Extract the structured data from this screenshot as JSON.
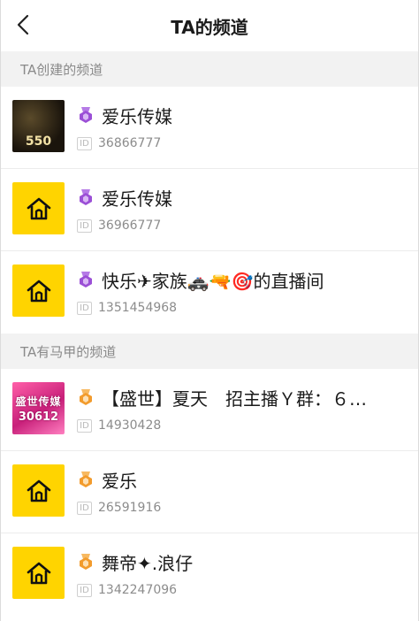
{
  "header": {
    "title": "TA的频道"
  },
  "sections": [
    {
      "title": "TA创建的频道",
      "items": [
        {
          "name": "爱乐传媒",
          "id": "36866777",
          "avatar_text": "550",
          "badge": "purple-medal-icon"
        },
        {
          "name": "爱乐传媒",
          "id": "36966777",
          "badge": "purple-medal-icon"
        },
        {
          "name": "快乐✈家族🚓🔫🎯的直播间",
          "id": "1351454968",
          "badge": "purple-medal-icon"
        }
      ]
    },
    {
      "title": "TA有马甲的频道",
      "items": [
        {
          "name": "【盛世】夏天　招主播Ｙ群：６…",
          "id": "14930428",
          "avatar_text": "盛世传媒",
          "avatar_text2": "30612",
          "badge": "orange-medal-icon"
        },
        {
          "name": "爱乐",
          "id": "26591916",
          "badge": "orange-medal-icon"
        },
        {
          "name": "舞帝✦.浪仔",
          "id": "1342247096",
          "badge": "orange-medal-icon"
        }
      ]
    }
  ],
  "colors": {
    "purple_badge": "#9b4fd6",
    "orange_badge": "#f29b2c",
    "yellow_avatar": "#ffd400"
  },
  "id_label": "ID"
}
